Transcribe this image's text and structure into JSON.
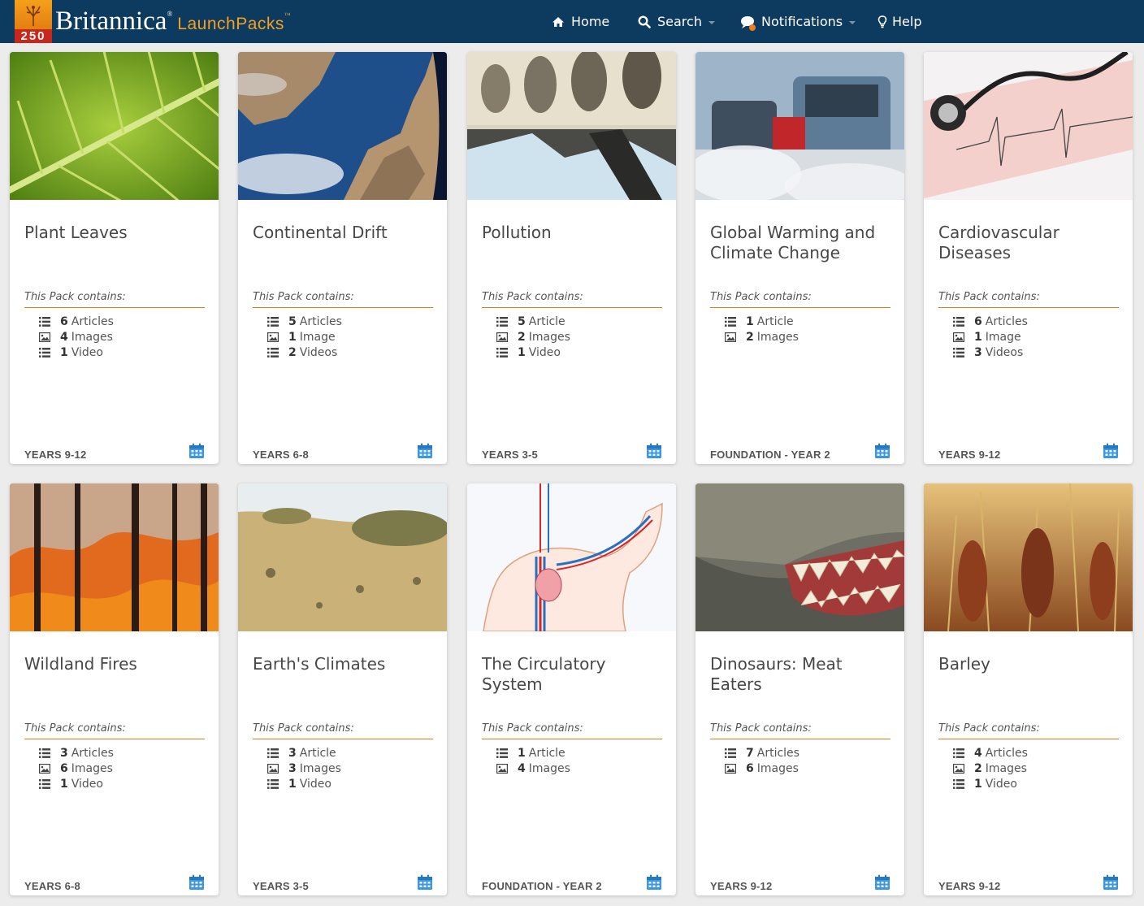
{
  "header": {
    "logo_number": "250",
    "brand_name": "Britannica",
    "brand_reg": "®",
    "brand_product": "LaunchPacks",
    "brand_tm": "™",
    "nav": {
      "home": "Home",
      "search": "Search",
      "notifications": "Notifications",
      "help": "Help"
    },
    "colors": {
      "bar": "#0d3a5f",
      "accent": "#f6a020",
      "notif_dot": "#f07f1a"
    }
  },
  "contains_label": "This Pack contains:",
  "cards": [
    {
      "title": "Plant Leaves",
      "grade": "YEARS 9-12",
      "image": "green-leaf",
      "items": [
        {
          "count": "6",
          "label": "Articles",
          "icon": "list-icon"
        },
        {
          "count": "4",
          "label": "Images",
          "icon": "image-icon"
        },
        {
          "count": "1",
          "label": "Video",
          "icon": "list-icon"
        }
      ]
    },
    {
      "title": "Continental Drift",
      "grade": "YEARS 6-8",
      "image": "earth-from-space",
      "items": [
        {
          "count": "5",
          "label": "Articles",
          "icon": "list-icon"
        },
        {
          "count": "1",
          "label": "Image",
          "icon": "image-icon"
        },
        {
          "count": "2",
          "label": "Videos",
          "icon": "list-icon"
        }
      ]
    },
    {
      "title": "Pollution",
      "grade": "YEARS 3-5",
      "image": "drain-pipes",
      "items": [
        {
          "count": "5",
          "label": "Article",
          "icon": "list-icon"
        },
        {
          "count": "2",
          "label": "Images",
          "icon": "image-icon"
        },
        {
          "count": "1",
          "label": "Video",
          "icon": "list-icon"
        }
      ]
    },
    {
      "title": "Global Warming and Climate Change",
      "grade": "FOUNDATION - YEAR 2",
      "image": "traffic-smog",
      "items": [
        {
          "count": "1",
          "label": "Article",
          "icon": "list-icon"
        },
        {
          "count": "2",
          "label": "Images",
          "icon": "image-icon"
        }
      ]
    },
    {
      "title": "Cardiovascular Diseases",
      "grade": "YEARS 9-12",
      "image": "stethoscope-ecg",
      "items": [
        {
          "count": "6",
          "label": "Articles",
          "icon": "list-icon"
        },
        {
          "count": "1",
          "label": "Image",
          "icon": "image-icon"
        },
        {
          "count": "3",
          "label": "Videos",
          "icon": "list-icon"
        }
      ]
    },
    {
      "title": "Wildland Fires",
      "grade": "YEARS 6-8",
      "image": "forest-fire",
      "items": [
        {
          "count": "3",
          "label": "Articles",
          "icon": "list-icon"
        },
        {
          "count": "6",
          "label": "Images",
          "icon": "image-icon"
        },
        {
          "count": "1",
          "label": "Video",
          "icon": "list-icon"
        }
      ]
    },
    {
      "title": "Earth's Climates",
      "grade": "YEARS 3-5",
      "image": "dry-grassland",
      "items": [
        {
          "count": "3",
          "label": "Article",
          "icon": "list-icon"
        },
        {
          "count": "3",
          "label": "Images",
          "icon": "image-icon"
        },
        {
          "count": "1",
          "label": "Video",
          "icon": "list-icon"
        }
      ]
    },
    {
      "title": "The Circulatory System",
      "grade": "FOUNDATION - YEAR 2",
      "image": "circulatory-diagram",
      "items": [
        {
          "count": "1",
          "label": "Article",
          "icon": "list-icon"
        },
        {
          "count": "4",
          "label": "Images",
          "icon": "image-icon"
        }
      ]
    },
    {
      "title": "Dinosaurs: Meat Eaters",
      "grade": "YEARS 9-12",
      "image": "t-rex-teeth",
      "items": [
        {
          "count": "7",
          "label": "Articles",
          "icon": "list-icon"
        },
        {
          "count": "6",
          "label": "Images",
          "icon": "image-icon"
        }
      ]
    },
    {
      "title": "Barley",
      "grade": "YEARS 9-12",
      "image": "barley-ears",
      "items": [
        {
          "count": "4",
          "label": "Articles",
          "icon": "list-icon"
        },
        {
          "count": "2",
          "label": "Images",
          "icon": "image-icon"
        },
        {
          "count": "1",
          "label": "Video",
          "icon": "list-icon"
        }
      ]
    }
  ]
}
